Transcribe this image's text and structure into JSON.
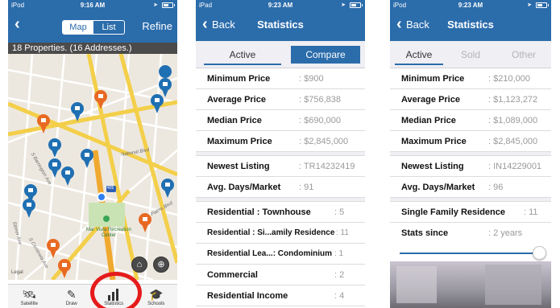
{
  "phone1": {
    "status": {
      "carrier": "iPod",
      "time": "9:16 AM"
    },
    "nav": {
      "map_label": "Map",
      "list_label": "List",
      "refine_label": "Refine"
    },
    "property_count": "18 Properties. (16 Addresses.)",
    "map": {
      "labels": {
        "national": "National Blvd",
        "palms": "Palms Blvd",
        "barrington": "S Barrington Ave",
        "centinela": "S Centinela Ave",
        "stoner": "Stoner Ave",
        "freeway": "405",
        "park": "Mar Vista Recreation Center",
        "legal": "Legal"
      }
    },
    "tabs": [
      {
        "label": "Satellite",
        "icon": "satellite-icon"
      },
      {
        "label": "Draw",
        "icon": "pencil-icon"
      },
      {
        "label": "Statistics",
        "icon": "bar-chart-icon"
      },
      {
        "label": "Schools",
        "icon": "graduation-cap-icon"
      }
    ],
    "highlight_color": "#e51b1b"
  },
  "phone2": {
    "status": {
      "carrier": "iPad",
      "time": "9:23 AM"
    },
    "nav": {
      "back_label": "Back",
      "title": "Statistics"
    },
    "tabs": {
      "active": "Active",
      "compare": "Compare"
    },
    "rows": [
      {
        "key": "Minimum Price",
        "value": ": $900"
      },
      {
        "key": "Average Price",
        "value": ": $756,838"
      },
      {
        "key": "Median Price",
        "value": ": $690,000"
      },
      {
        "key": "Maximum Price",
        "value": ": $2,845,000"
      }
    ],
    "rows2": [
      {
        "key": "Newest Listing",
        "value": ": TR14232419"
      },
      {
        "key": "Avg. Days/Market",
        "value": ": 91"
      }
    ],
    "rows3": [
      {
        "key": "Residential : Townhouse",
        "value": ": 5"
      },
      {
        "key": "Residential : Si...amily Residence",
        "value": ": 11"
      },
      {
        "key": "Residential Lea...: Condominium",
        "value": ": 1"
      },
      {
        "key": "Commercial",
        "value": ": 2"
      },
      {
        "key": "Residential Income",
        "value": ": 4"
      }
    ]
  },
  "phone3": {
    "status": {
      "carrier": "iPod",
      "time": "9:23 AM"
    },
    "nav": {
      "back_label": "Back",
      "title": "Statistics"
    },
    "tabs": {
      "active": "Active",
      "sold": "Sold",
      "other": "Other"
    },
    "rows": [
      {
        "key": "Minimum Price",
        "value": ": $210,000"
      },
      {
        "key": "Average Price",
        "value": ": $1,123,272"
      },
      {
        "key": "Median Price",
        "value": ": $1,089,000"
      },
      {
        "key": "Maximum Price",
        "value": ": $2,845,000"
      }
    ],
    "rows2": [
      {
        "key": "Newest Listing",
        "value": ": IN14229001"
      },
      {
        "key": "Avg. Days/Market",
        "value": ": 96"
      }
    ],
    "rows3": [
      {
        "key": "Single Family Residence",
        "value": ": 11"
      },
      {
        "key": "Stats since",
        "value": ": 2 years"
      }
    ],
    "slider_level": 1.0
  },
  "colors": {
    "brand": "#2b6cab",
    "pin_blue": "#1f6fb3",
    "pin_orange": "#e86a22"
  }
}
